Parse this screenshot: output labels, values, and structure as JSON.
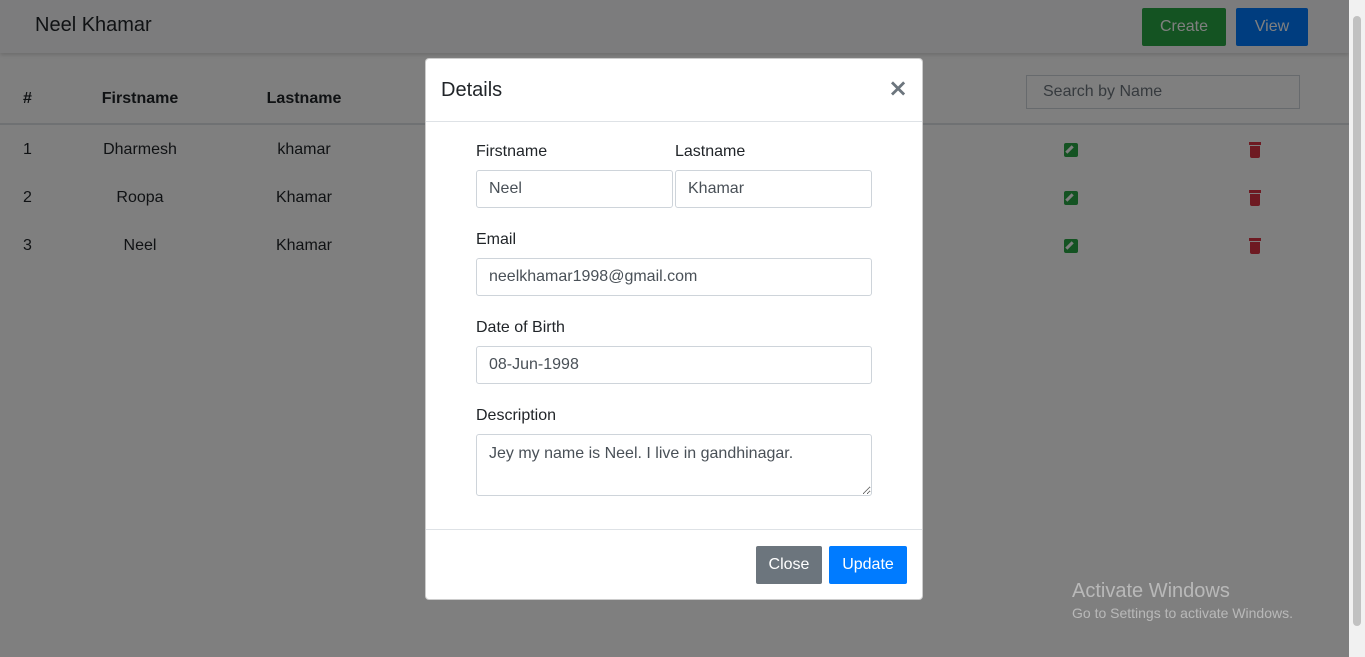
{
  "navbar": {
    "brand": "Neel Khamar",
    "create_label": "Create",
    "view_label": "View"
  },
  "table": {
    "headers": [
      "#",
      "Firstname",
      "Lastname"
    ],
    "search_placeholder": "Search by Name",
    "rows": [
      {
        "num": "1",
        "firstname": "Dharmesh",
        "lastname": "khamar"
      },
      {
        "num": "2",
        "firstname": "Roopa",
        "lastname": "Khamar"
      },
      {
        "num": "3",
        "firstname": "Neel",
        "lastname": "Khamar"
      }
    ],
    "row_icons": [
      "edit-icon",
      "trash-icon"
    ]
  },
  "modal": {
    "title": "Details",
    "close_symbol": "×",
    "firstname_label": "Firstname",
    "firstname_value": "Neel",
    "lastname_label": "Lastname",
    "lastname_value": "Khamar",
    "email_label": "Email",
    "email_value": "neelkhamar1998@gmail.com",
    "dob_label": "Date of Birth",
    "dob_value": "08-Jun-1998",
    "description_label": "Description",
    "description_value": "Jey my name is Neel. I live in gandhinagar.",
    "close_button": "Close",
    "update_button": "Update"
  },
  "watermark": {
    "title": "Activate Windows",
    "subtitle": "Go to Settings to activate Windows."
  },
  "colors": {
    "create": "#28a745",
    "view": "#007bff",
    "edit_icon": "#28a745",
    "trash_icon": "#dc3545",
    "close_button": "#6c757d",
    "update_button": "#007bff"
  }
}
